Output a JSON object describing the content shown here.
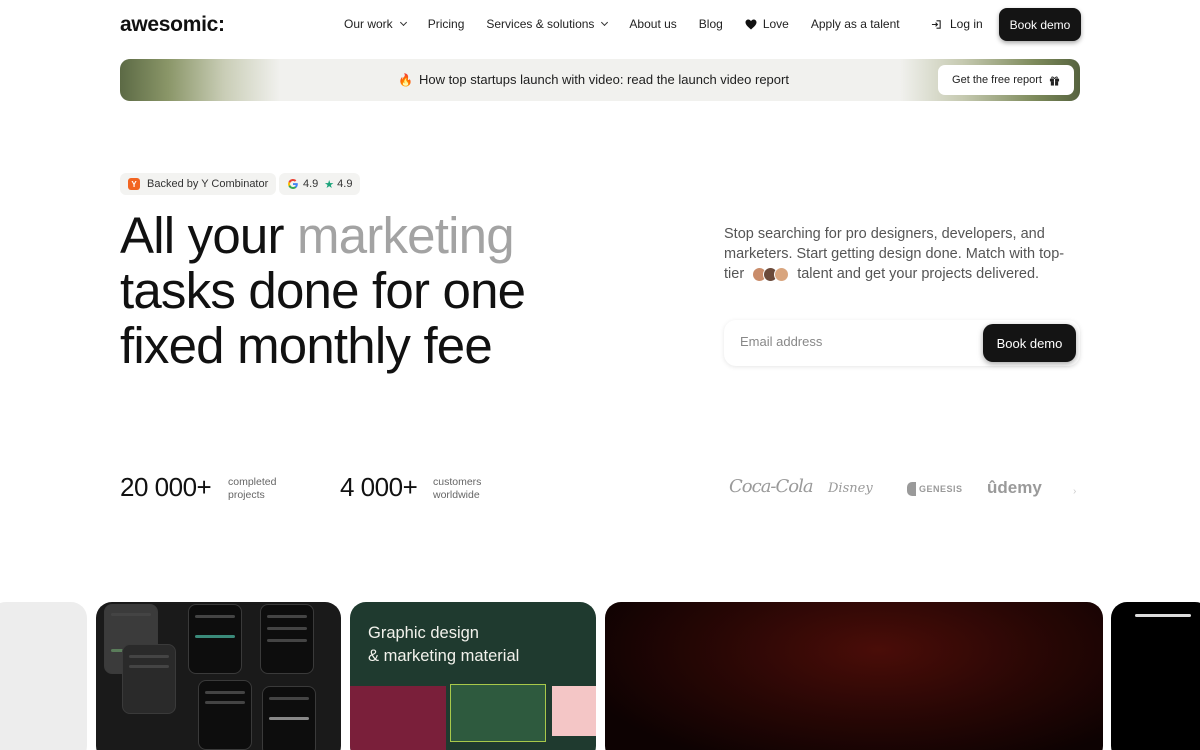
{
  "nav": {
    "logo": "awesomic:",
    "links": [
      "Our work",
      "Pricing",
      "Services & solutions",
      "About us",
      "Blog",
      "Love",
      "Apply as a talent"
    ],
    "login": "Log in",
    "book_demo": "Book demo"
  },
  "banner": {
    "text": "How top startups launch with video: read the launch video report",
    "button": "Get the free report"
  },
  "badges": {
    "yc": "Backed by Y Combinator",
    "google_rating": "4.9",
    "trustpilot_rating": "4.9"
  },
  "hero": {
    "title_line1_a": "All your ",
    "title_line1_b": "marketing",
    "title_line2": "tasks done for one",
    "title_line3": "fixed monthly fee",
    "desc_a": "Stop searching for pro designers, developers, and marketers. Start getting design done. Match with top-tier",
    "desc_b": "talent and get your projects delivered.",
    "email_placeholder": "Email address",
    "book_demo": "Book demo"
  },
  "stats": [
    {
      "number": "20 000+",
      "label_1": "completed",
      "label_2": "projects"
    },
    {
      "number": "4 000+",
      "label_1": "customers",
      "label_2": "worldwide"
    }
  ],
  "client_logos": [
    "Coca-Cola",
    "Disney",
    "GENESIS",
    "ûdemy"
  ],
  "cards": {
    "graphic_title_1": "Graphic design",
    "graphic_title_2": "& marketing material"
  },
  "colors": {
    "accent_dark": "#141414",
    "muted_text": "#a3a3a3",
    "graphic_card_bg": "#1f3a2f",
    "yc_orange": "#f26522"
  }
}
